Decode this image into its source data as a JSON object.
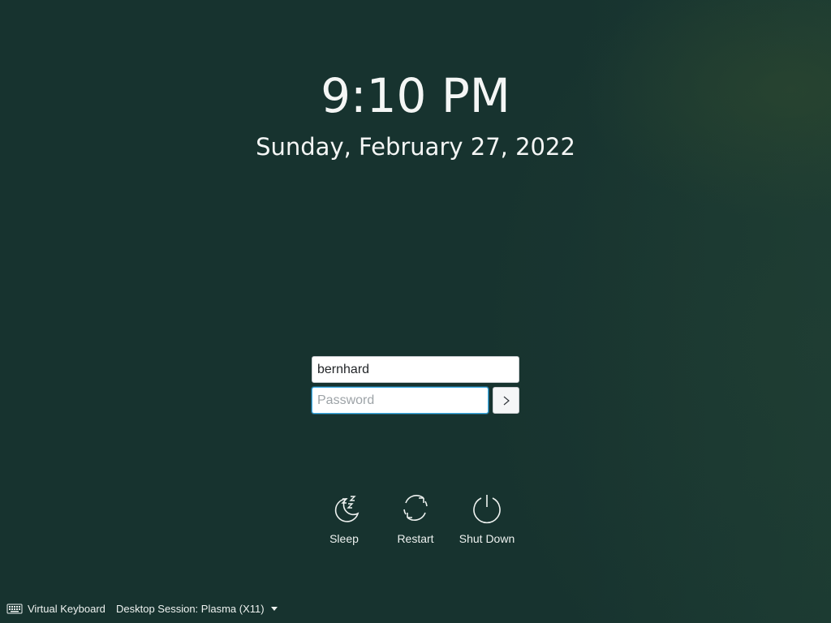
{
  "clock": {
    "time": "9:10 PM",
    "date": "Sunday, February 27, 2022"
  },
  "login": {
    "username_value": "bernhard",
    "password_placeholder": "Password",
    "submit_icon": "chevron-right-icon"
  },
  "actions": [
    {
      "label": "Sleep",
      "icon": "sleep-icon"
    },
    {
      "label": "Restart",
      "icon": "restart-icon"
    },
    {
      "label": "Shut Down",
      "icon": "power-icon"
    }
  ],
  "footer": {
    "virtual_keyboard_label": "Virtual Keyboard",
    "virtual_keyboard_icon": "keyboard-icon",
    "session_label": "Desktop Session: Plasma (X11)",
    "session_icon": "caret-down-icon"
  },
  "colors": {
    "background": "#17332f",
    "text": "#eef2f0",
    "focus_accent": "#3daee9"
  }
}
